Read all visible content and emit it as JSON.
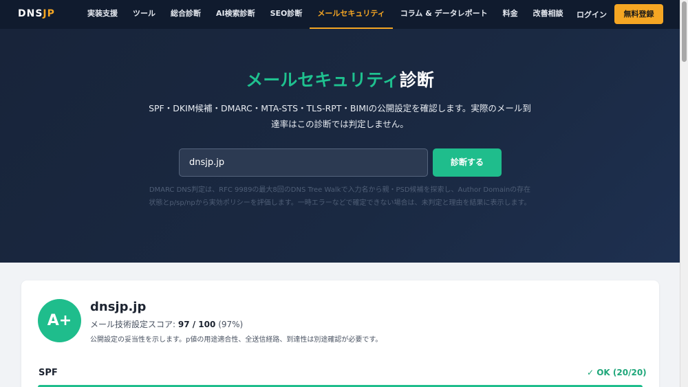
{
  "nav": {
    "logo_main": "DNS",
    "logo_accent": "JP",
    "items": [
      {
        "label": "実装支援"
      },
      {
        "label": "ツール"
      },
      {
        "label": "総合診断"
      },
      {
        "label": "AI検索診断"
      },
      {
        "label": "SEO診断"
      },
      {
        "label": "メールセキュリティ",
        "active": true
      },
      {
        "label": "コラム & データレポート"
      },
      {
        "label": "料金"
      },
      {
        "label": "改善相談"
      }
    ],
    "login_label": "ログイン",
    "signup_label": "無料登録"
  },
  "hero": {
    "title_accent": "メールセキュリティ",
    "title_rest": "診断",
    "description": "SPF・DKIM候補・DMARC・MTA-STS・TLS-RPT・BIMIの公開設定を確認します。実際のメール到達率はこの診断では判定しません。",
    "input_value": "dnsjp.jp",
    "button_label": "診断する",
    "note": "DMARC DNS判定は、RFC 9989の最大8回のDNS Tree Walkで入力名から親・PSD候補を探索し、Author Domainの存在状態とp/sp/npから実効ポリシーを評価します。一時エラーなどで確定できない場合は、未判定と理由を結果に表示します。"
  },
  "result": {
    "grade": "A+",
    "domain": "dnsjp.jp",
    "score_label": "メール技術設定スコア: ",
    "score_value": "97 / 100",
    "score_percent": "(97%)",
    "note": "公開設定の妥当性を示します。p値の用途適合性、全送信経路、到達性は別途確認が必要です。",
    "sections": [
      {
        "name": "SPF",
        "status": "✓ OK (20/20)"
      }
    ]
  },
  "colors": {
    "accent_green": "#1fbd8c",
    "accent_orange": "#f5a623",
    "navy": "#101b2e"
  }
}
